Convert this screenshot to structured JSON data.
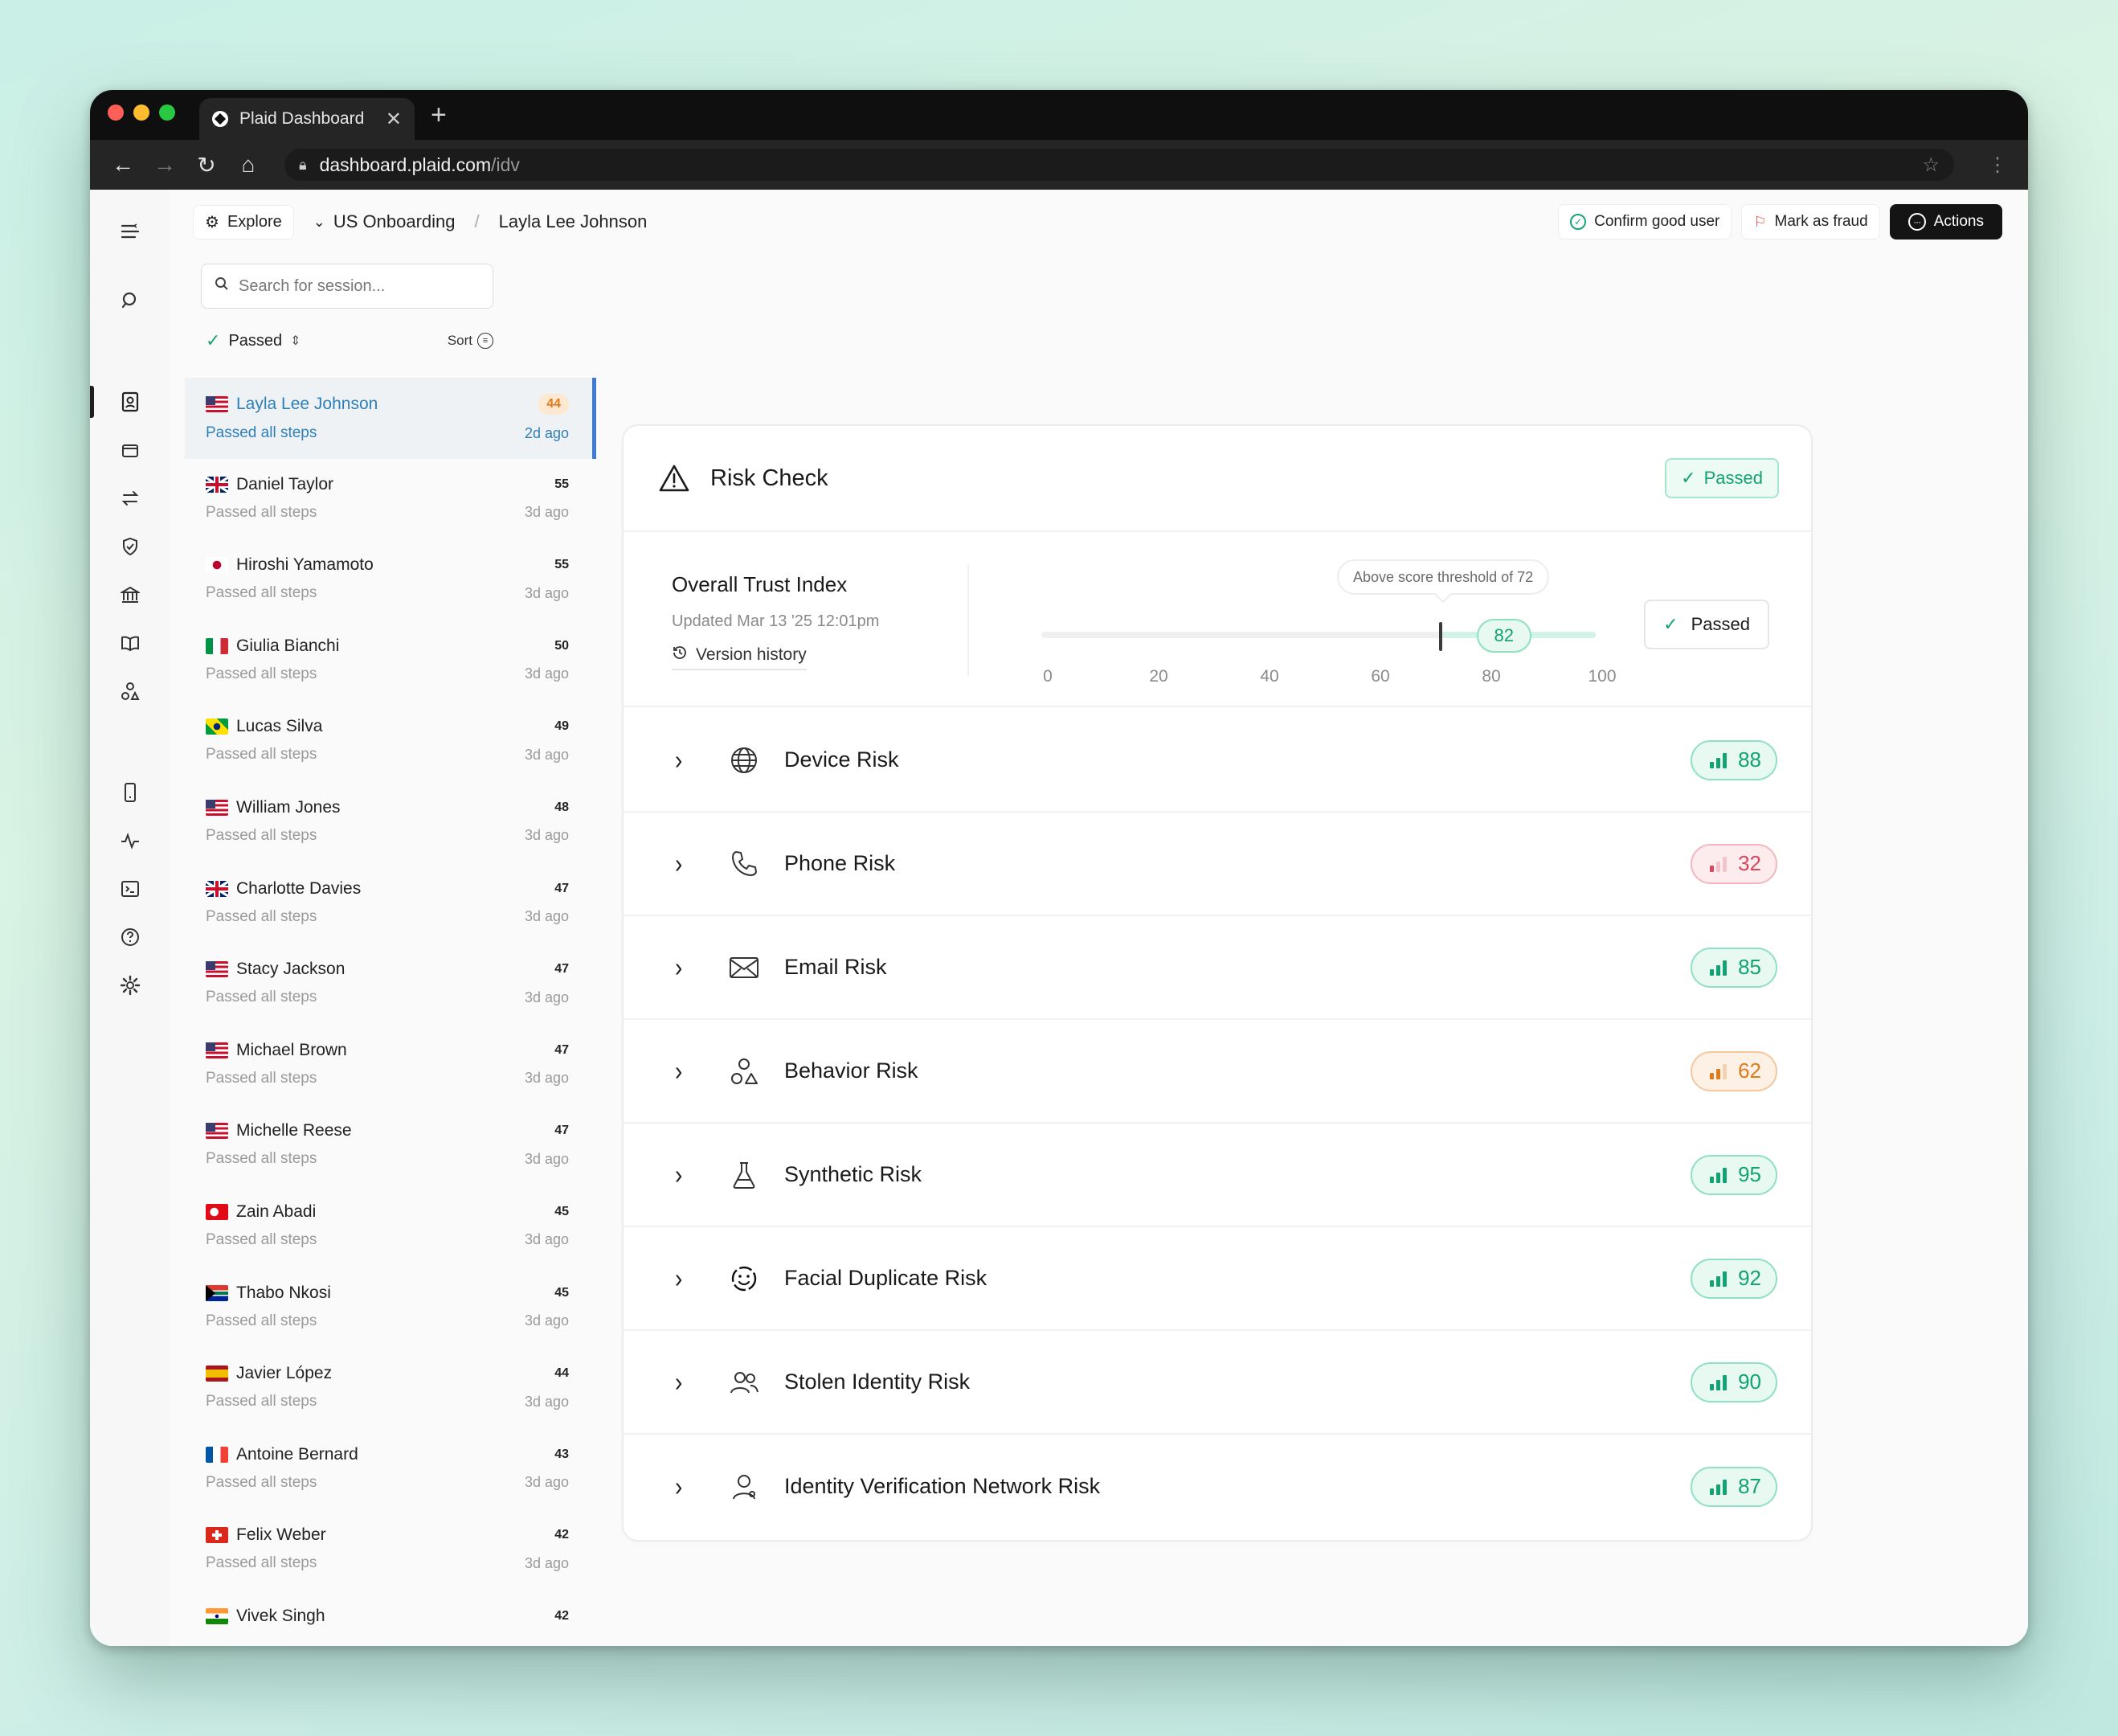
{
  "browser": {
    "tab_title": "Plaid Dashboard",
    "url_host": "dashboard.plaid.com",
    "url_path": "/idv"
  },
  "topbar": {
    "explore": "Explore",
    "breadcrumb_flow": "US Onboarding",
    "breadcrumb_user": "Layla Lee Johnson",
    "confirm_good_user": "Confirm good user",
    "mark_as_fraud": "Mark as fraud",
    "actions": "Actions"
  },
  "sidebar": {
    "search_placeholder": "Search for session...",
    "filter_label": "Passed",
    "sort_label": "Sort",
    "sessions": [
      {
        "name": "Layla Lee Johnson",
        "status": "Passed all steps",
        "score": "44",
        "time": "2d ago",
        "flag": "us"
      },
      {
        "name": "Daniel Taylor",
        "status": "Passed all steps",
        "score": "55",
        "time": "3d ago",
        "flag": "gb"
      },
      {
        "name": "Hiroshi Yamamoto",
        "status": "Passed all steps",
        "score": "55",
        "time": "3d ago",
        "flag": "jp"
      },
      {
        "name": "Giulia Bianchi",
        "status": "Passed all steps",
        "score": "50",
        "time": "3d ago",
        "flag": "it"
      },
      {
        "name": "Lucas Silva",
        "status": "Passed all steps",
        "score": "49",
        "time": "3d ago",
        "flag": "br"
      },
      {
        "name": "William Jones",
        "status": "Passed all steps",
        "score": "48",
        "time": "3d ago",
        "flag": "us"
      },
      {
        "name": "Charlotte Davies",
        "status": "Passed all steps",
        "score": "47",
        "time": "3d ago",
        "flag": "gb"
      },
      {
        "name": "Stacy Jackson",
        "status": "Passed all steps",
        "score": "47",
        "time": "3d ago",
        "flag": "us"
      },
      {
        "name": "Michael Brown",
        "status": "Passed all steps",
        "score": "47",
        "time": "3d ago",
        "flag": "us"
      },
      {
        "name": "Michelle Reese",
        "status": "Passed all steps",
        "score": "47",
        "time": "3d ago",
        "flag": "us"
      },
      {
        "name": "Zain Abadi",
        "status": "Passed all steps",
        "score": "45",
        "time": "3d ago",
        "flag": "tr"
      },
      {
        "name": "Thabo Nkosi",
        "status": "Passed all steps",
        "score": "45",
        "time": "3d ago",
        "flag": "za"
      },
      {
        "name": "Javier López",
        "status": "Passed all steps",
        "score": "44",
        "time": "3d ago",
        "flag": "es"
      },
      {
        "name": "Antoine Bernard",
        "status": "Passed all steps",
        "score": "43",
        "time": "3d ago",
        "flag": "fr"
      },
      {
        "name": "Felix Weber",
        "status": "Passed all steps",
        "score": "42",
        "time": "3d ago",
        "flag": "ch"
      },
      {
        "name": "Vivek Singh",
        "status": "",
        "score": "42",
        "time": "",
        "flag": "in"
      }
    ]
  },
  "risk_check": {
    "title": "Risk Check",
    "status": "Passed",
    "trust_index": {
      "title": "Overall Trust Index",
      "updated": "Updated Mar 13 '25 12:01pm",
      "version_history": "Version history",
      "score": 82,
      "threshold": 72,
      "threshold_tooltip": "Above score threshold of 72",
      "scale_ticks": [
        "0",
        "20",
        "40",
        "60",
        "80",
        "100"
      ],
      "scale_min": 0,
      "scale_max": 100,
      "status": "Passed"
    },
    "risks": [
      {
        "label": "Device Risk",
        "score": "88",
        "level": "green",
        "icon": "globe-icon"
      },
      {
        "label": "Phone Risk",
        "score": "32",
        "level": "red",
        "icon": "phone-icon"
      },
      {
        "label": "Email Risk",
        "score": "85",
        "level": "green",
        "icon": "envelope-icon"
      },
      {
        "label": "Behavior Risk",
        "score": "62",
        "level": "orange",
        "icon": "shapes-icon"
      },
      {
        "label": "Synthetic Risk",
        "score": "95",
        "level": "green",
        "icon": "flask-icon"
      },
      {
        "label": "Facial Duplicate Risk",
        "score": "92",
        "level": "green",
        "icon": "face-icon"
      },
      {
        "label": "Stolen Identity Risk",
        "score": "90",
        "level": "green",
        "icon": "users-icon"
      },
      {
        "label": "Identity Verification Network Risk",
        "score": "87",
        "level": "green",
        "icon": "user-network-icon"
      }
    ]
  },
  "colors": {
    "green": "#12a274",
    "red": "#d9475c",
    "orange": "#e07b1c",
    "selected_blue": "#2f7fb8"
  }
}
